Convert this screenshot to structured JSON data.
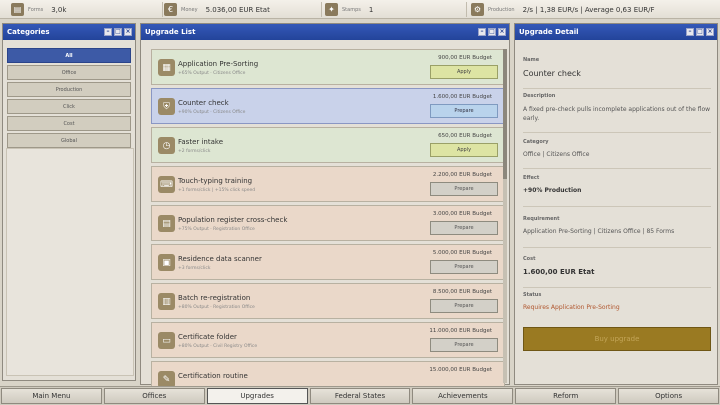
{
  "topbar": {
    "stats": [
      {
        "icon": "forms-icon",
        "label": "Forms",
        "value": "3,0k"
      },
      {
        "icon": "money-icon",
        "label": "Money",
        "value": "5.036,00 EUR Etat"
      },
      {
        "icon": "stamps-icon",
        "label": "Stamps",
        "value": "1"
      },
      {
        "icon": "production-icon",
        "label": "Production",
        "value": "2/s | 1,38 EUR/s | Average 0,63 EUR/F"
      }
    ]
  },
  "categories": {
    "title": "Categories",
    "items": [
      "All",
      "Office",
      "Production",
      "Click",
      "Cost",
      "Global"
    ],
    "active": "All"
  },
  "upgrade_list": {
    "title": "Upgrade List",
    "items": [
      {
        "name": "Application Pre-Sorting",
        "desc": "+65% Output · Citizens Office",
        "cost": "900,00 EUR Budget",
        "button": "Apply",
        "style": "green",
        "icon": "sorting-icon"
      },
      {
        "name": "Counter check",
        "desc": "+90% Output · Citizens Office",
        "cost": "1.600,00 EUR Budget",
        "button": "Prepare",
        "style": "blue",
        "icon": "shield-icon"
      },
      {
        "name": "Faster intake",
        "desc": "+2 forms/click",
        "cost": "650,00 EUR Budget",
        "button": "Apply",
        "style": "green",
        "icon": "stopwatch-icon"
      },
      {
        "name": "Touch-typing training",
        "desc": "+1 forms/click | +15% click speed",
        "cost": "2.200,00 EUR Budget",
        "button": "Prepare",
        "style": "tan",
        "icon": "keyboard-icon"
      },
      {
        "name": "Population register cross-check",
        "desc": "+75% Output · Registration Office",
        "cost": "3.000,00 EUR Budget",
        "button": "Prepare",
        "style": "tan",
        "icon": "register-icon"
      },
      {
        "name": "Residence data scanner",
        "desc": "+3 forms/click",
        "cost": "5.000,00 EUR Budget",
        "button": "Prepare",
        "style": "tan",
        "icon": "scanner-icon"
      },
      {
        "name": "Batch re-registration",
        "desc": "+80% Output · Registration Office",
        "cost": "8.500,00 EUR Budget",
        "button": "Prepare",
        "style": "tan",
        "icon": "batch-icon"
      },
      {
        "name": "Certificate folder",
        "desc": "+80% Output · Civil Registry Office",
        "cost": "11.000,00 EUR Budget",
        "button": "Prepare",
        "style": "tan",
        "icon": "folder-icon"
      },
      {
        "name": "Certification routine",
        "desc": "",
        "cost": "15.000,00 EUR Budget",
        "button": "",
        "style": "tan",
        "icon": "certificate-icon"
      }
    ]
  },
  "detail": {
    "title": "Upgrade Detail",
    "name_label": "Name",
    "name": "Counter check",
    "description_label": "Description",
    "description": "A fixed pre-check pulls incomplete applications out of the flow early.",
    "category_label": "Category",
    "category": "Office | Citizens Office",
    "effect_label": "Effect",
    "effect": "+90% Production",
    "requirement_label": "Requirement",
    "requirement": "Application Pre-Sorting | Citizens Office | 85 Forms",
    "cost_label": "Cost",
    "cost": "1.600,00 EUR Etat",
    "status_label": "Status",
    "status": "Requires Application Pre-Sorting",
    "buy_button": "Buy upgrade"
  },
  "nav": {
    "tabs": [
      "Main Menu",
      "Offices",
      "Upgrades",
      "Federal States",
      "Achievements",
      "Reform",
      "Options"
    ],
    "active": "Upgrades"
  }
}
